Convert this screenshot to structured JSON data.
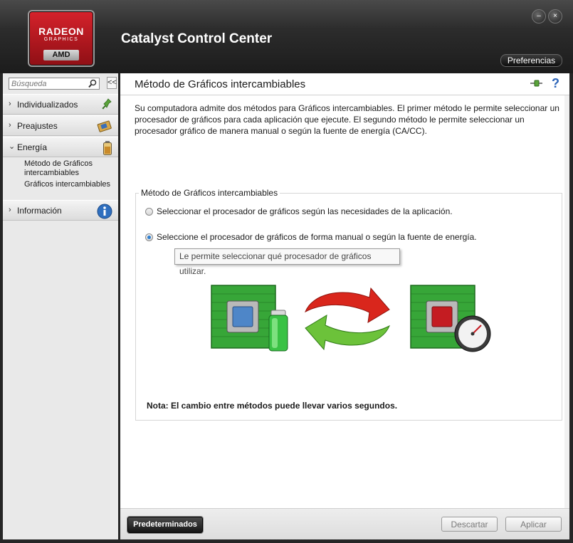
{
  "app": {
    "title": "Catalyst Control Center",
    "logo": {
      "line1": "RADEON",
      "line2": "GRAPHICS",
      "line3": "AMD"
    },
    "preferences_label": "Preferencias",
    "minimize_icon": "minimize-icon",
    "close_icon": "close-icon"
  },
  "sidebar": {
    "search_placeholder": "Búsqueda",
    "collapse_label": "<<",
    "items": [
      {
        "label": "Individualizados",
        "icon": "pin-icon",
        "expanded": false
      },
      {
        "label": "Preajustes",
        "icon": "card-icon",
        "expanded": false
      },
      {
        "label": "Energía",
        "icon": "battery-icon",
        "expanded": true
      },
      {
        "label": "Información",
        "icon": "info-icon",
        "expanded": false
      }
    ],
    "subitems": [
      {
        "label": "Método de Gráficos intercambiables"
      },
      {
        "label": "Gráficos intercambiables"
      }
    ]
  },
  "main": {
    "title": "Método de Gráficos intercambiables",
    "description": "Su computadora admite dos métodos para Gráficos intercambiables. El primer método le permite seleccionar un procesador de gráficos para cada aplicación que ejecute. El segundo método le permite seleccionar un procesador gráfico de manera manual o según la fuente de energía (CA/CC).",
    "group_legend": "Método de Gráficos intercambiables",
    "options": [
      {
        "label": "Seleccionar el procesador de gráficos según las necesidades de la aplicación.",
        "selected": false
      },
      {
        "label": "Seleccione el procesador de gráficos de forma manual o según la fuente de energía.",
        "selected": true
      }
    ],
    "tooltip": "Le permite seleccionar qué procesador de gráficos utilizar.",
    "note": "Nota: El cambio entre métodos puede llevar varios segundos."
  },
  "footer": {
    "defaults_label": "Predeterminados",
    "discard_label": "Descartar",
    "apply_label": "Aplicar"
  },
  "colors": {
    "accent_red": "#c8141c",
    "chip_green": "#33a32f",
    "radio_selected": "#2f7fd0"
  }
}
